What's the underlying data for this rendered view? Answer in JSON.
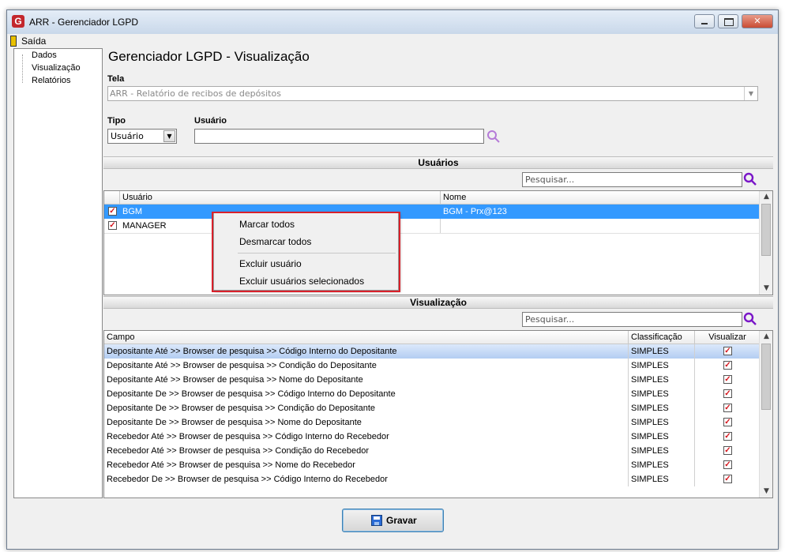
{
  "window": {
    "title": "ARR - Gerenciador LGPD",
    "logo": "G"
  },
  "menu": {
    "exit_label": "Saída"
  },
  "tree": {
    "items": [
      "Dados",
      "Visualização",
      "Relatórios"
    ]
  },
  "page": {
    "title": "Gerenciador LGPD - Visualização"
  },
  "form": {
    "tela_label": "Tela",
    "tela_value": "ARR - Relatório de recibos de depósitos",
    "tipo_label": "Tipo",
    "tipo_value": "Usuário",
    "usuario_label": "Usuário",
    "usuario_value": ""
  },
  "usuarios": {
    "section_title": "Usuários",
    "search_placeholder": "Pesquisar...",
    "columns": [
      "Usuário",
      "Nome"
    ],
    "rows": [
      {
        "usuario": "BGM",
        "nome": "BGM - Prx@123",
        "checked": true,
        "selected": true
      },
      {
        "usuario": "MANAGER",
        "nome": "",
        "checked": true,
        "selected": false
      }
    ]
  },
  "context_menu": {
    "items": [
      "Marcar todos",
      "Desmarcar todos",
      "Excluir usuário",
      "Excluir usuários selecionados"
    ]
  },
  "visualizacao": {
    "section_title": "Visualização",
    "search_placeholder": "Pesquisar...",
    "columns": [
      "Campo",
      "Classificação",
      "Visualizar"
    ],
    "rows": [
      {
        "campo": "Depositante Até >> Browser de pesquisa >> Código Interno do Depositante",
        "classificacao": "SIMPLES",
        "visualizar": true
      },
      {
        "campo": "Depositante Até >> Browser de pesquisa >> Condição do Depositante",
        "classificacao": "SIMPLES",
        "visualizar": true
      },
      {
        "campo": "Depositante Até >> Browser de pesquisa >> Nome do Depositante",
        "classificacao": "SIMPLES",
        "visualizar": true
      },
      {
        "campo": "Depositante De >> Browser de pesquisa >> Código Interno do Depositante",
        "classificacao": "SIMPLES",
        "visualizar": true
      },
      {
        "campo": "Depositante De >> Browser de pesquisa >> Condição do Depositante",
        "classificacao": "SIMPLES",
        "visualizar": true
      },
      {
        "campo": "Depositante De >> Browser de pesquisa >> Nome do Depositante",
        "classificacao": "SIMPLES",
        "visualizar": true
      },
      {
        "campo": "Recebedor Até >> Browser de pesquisa >> Código Interno do Recebedor",
        "classificacao": "SIMPLES",
        "visualizar": true
      },
      {
        "campo": "Recebedor Até >> Browser de pesquisa >> Condição do Recebedor",
        "classificacao": "SIMPLES",
        "visualizar": true
      },
      {
        "campo": "Recebedor Até >> Browser de pesquisa >> Nome do Recebedor",
        "classificacao": "SIMPLES",
        "visualizar": true
      },
      {
        "campo": "Recebedor De >> Browser de pesquisa >> Código Interno do Recebedor",
        "classificacao": "SIMPLES",
        "visualizar": true
      }
    ]
  },
  "actions": {
    "save_label": "Gravar"
  },
  "colors": {
    "selection": "#3399ff",
    "accent_red": "#d9202a",
    "search_icon": "#8a2be2"
  }
}
